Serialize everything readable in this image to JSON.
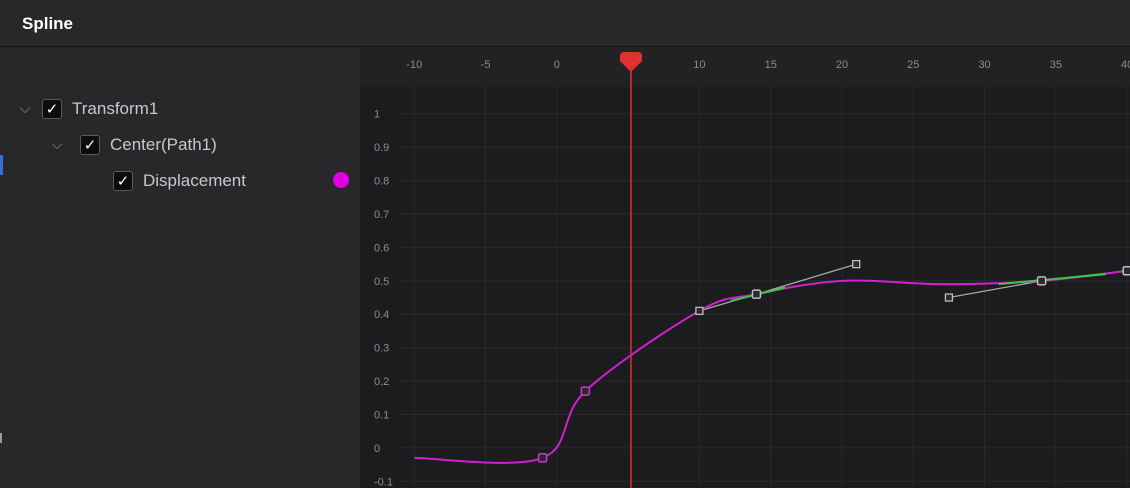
{
  "panel": {
    "title": "Spline"
  },
  "tree": {
    "items": [
      {
        "label": "Transform1",
        "checked": true,
        "expanded": true,
        "icon": "chevron-down-icon"
      },
      {
        "label": "Center(Path1)",
        "checked": true,
        "expanded": true,
        "icon": "chevron-down-icon"
      },
      {
        "label": "Displacement",
        "checked": true,
        "color": "#e000e0"
      }
    ],
    "chevron_glyph": "⌵",
    "check_glyph": "✓"
  },
  "chart_data": {
    "type": "line",
    "x_ticks": [
      "-10",
      "-5",
      "0",
      "10",
      "15",
      "20",
      "25",
      "30",
      "35",
      "40"
    ],
    "y_ticks": [
      "1",
      "0.9",
      "0.8",
      "0.7",
      "0.6",
      "0.5",
      "0.4",
      "0.3",
      "0.2",
      "0.1",
      "0",
      "-0.1"
    ],
    "x_tick_values": [
      -10,
      -5,
      0,
      10,
      15,
      20,
      25,
      30,
      35,
      40
    ],
    "y_tick_values": [
      1,
      0.9,
      0.8,
      0.7,
      0.6,
      0.5,
      0.4,
      0.3,
      0.2,
      0.1,
      0,
      -0.1
    ],
    "xlim": [
      -11,
      40.2
    ],
    "ylim": [
      -0.12,
      1.08
    ],
    "playhead_frame": 5.2,
    "series": [
      {
        "color": "#d020d0",
        "points": [
          [
            -10,
            -0.03
          ],
          [
            -1,
            -0.03
          ],
          [
            2,
            0.17
          ],
          [
            10,
            0.41
          ],
          [
            14,
            0.46
          ],
          [
            20,
            0.5
          ],
          [
            27,
            0.49
          ],
          [
            34,
            0.5
          ],
          [
            40,
            0.53
          ]
        ]
      }
    ],
    "keyframes": [
      {
        "x": -1,
        "y": -0.03,
        "color": "#c040c0"
      },
      {
        "x": 2,
        "y": 0.17,
        "color": "#c040c0"
      },
      {
        "x": 14,
        "y": 0.46,
        "color": "#bfbfbf"
      },
      {
        "x": 34,
        "y": 0.5,
        "color": "#bfbfbf"
      },
      {
        "x": 40,
        "y": 0.53,
        "color": "#bfbfbf"
      }
    ],
    "handles": [
      {
        "from": [
          14,
          0.46
        ],
        "to": [
          10,
          0.41
        ]
      },
      {
        "from": [
          14,
          0.46
        ],
        "to": [
          21,
          0.55
        ]
      },
      {
        "from": [
          34,
          0.5
        ],
        "to": [
          27.5,
          0.45
        ]
      },
      {
        "from": [
          34,
          0.5
        ],
        "to": [
          40,
          0.53
        ]
      }
    ],
    "colors": {
      "background": "#1c1c1f",
      "grid": "#2a2a2e",
      "playhead": "#e03030",
      "handle": "#a8a8ac",
      "selected_segment": "#39c93a"
    }
  }
}
